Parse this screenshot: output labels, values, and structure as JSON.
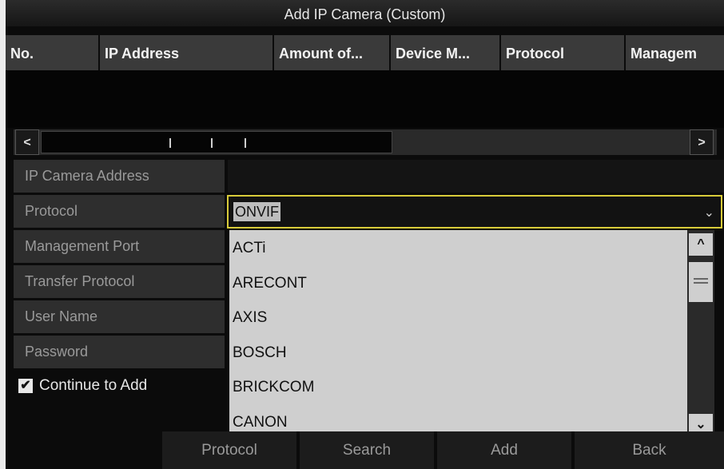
{
  "window": {
    "title": "Add IP Camera (Custom)"
  },
  "table": {
    "columns": [
      "No.",
      "IP Address",
      "Amount of...",
      "Device M...",
      "Protocol",
      "Managem"
    ]
  },
  "hscroll": {
    "left_arrow": "<",
    "right_arrow": ">"
  },
  "form": {
    "ip_camera_address_label": "IP Camera Address",
    "protocol_label": "Protocol",
    "management_port_label": "Management Port",
    "transfer_protocol_label": "Transfer Protocol",
    "user_name_label": "User Name",
    "password_label": "Password",
    "protocol_value": "ONVIF"
  },
  "dropdown": {
    "options": [
      "ACTi",
      "ARECONT",
      "AXIS",
      "BOSCH",
      "BRICKCOM",
      "CANON"
    ],
    "up_arrow": "^",
    "down_arrow": "⌄"
  },
  "continue_to_add": {
    "label": "Continue to Add",
    "checked": true,
    "check_glyph": "✔"
  },
  "buttons": {
    "protocol": "Protocol",
    "search": "Search",
    "add": "Add",
    "back": "Back"
  },
  "colors": {
    "focus_border": "#d9cc3a",
    "header_bg": "#3a3a3a",
    "dropdown_bg": "#cfcfcf"
  }
}
